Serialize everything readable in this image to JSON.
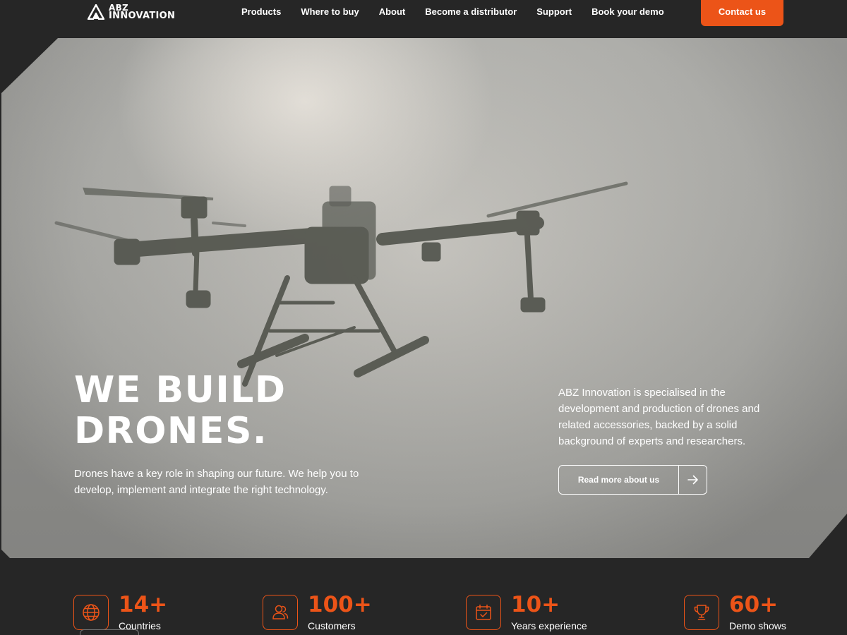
{
  "header": {
    "logo_line1": "ABZ",
    "logo_line2": "INNOVATION",
    "nav": [
      "Products",
      "Where to buy",
      "About",
      "Become a distributor",
      "Support",
      "Book your demo"
    ],
    "contact_label": "Contact us"
  },
  "hero": {
    "title_line1": "WE BUILD",
    "title_line2": "DRONES.",
    "subtitle": "Drones have a key role in shaping our future. We help you to develop, implement and integrate the right technology.",
    "description": "ABZ Innovation is specialised in the development and production of drones and related accessories, backed by a solid background of experts and researchers.",
    "read_more_label": "Read more about us"
  },
  "stats": [
    {
      "value": "14+",
      "label": "Countries",
      "icon": "globe-icon"
    },
    {
      "value": "100+",
      "label": "Customers",
      "icon": "users-icon"
    },
    {
      "value": "10+",
      "label": "Years experience",
      "icon": "calendar-check-icon"
    },
    {
      "value": "60+",
      "label": "Demo shows",
      "icon": "trophy-icon"
    }
  ],
  "colors": {
    "background": "#262626",
    "accent": "#ec5418",
    "text": "#ffffff"
  }
}
